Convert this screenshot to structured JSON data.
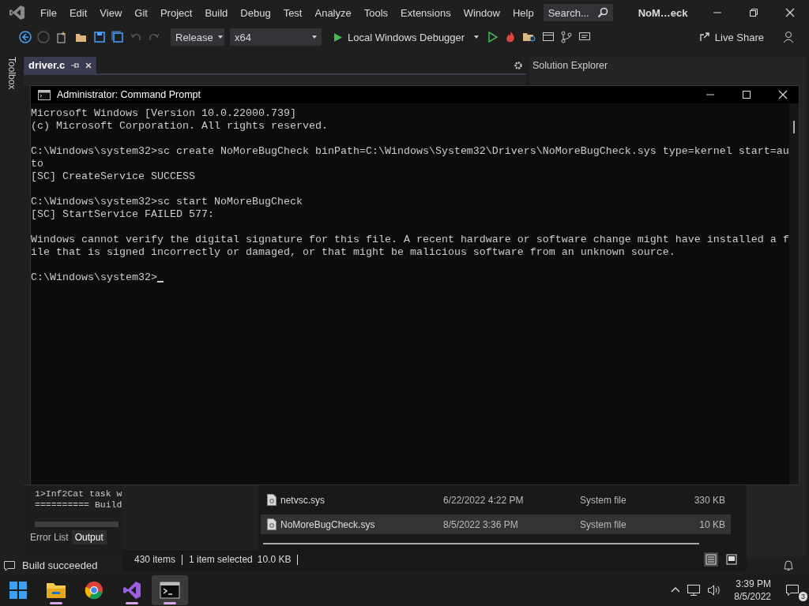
{
  "ide": {
    "title": "NoM…eck",
    "menu": [
      "File",
      "Edit",
      "View",
      "Git",
      "Project",
      "Build",
      "Debug",
      "Test",
      "Analyze",
      "Tools",
      "Extensions",
      "Window",
      "Help"
    ],
    "search": {
      "placeholder": "Search..."
    },
    "toolbar": {
      "configuration": "Release",
      "platform": "x64",
      "debugger": "Local Windows Debugger",
      "live_share": "Live Share"
    },
    "toolbox_label": "Toolbox",
    "document_tabs": [
      {
        "label": "driver.c",
        "selected": true
      }
    ],
    "solution_explorer": {
      "title": "Solution Explorer"
    },
    "output": {
      "lines": [
        "1>Inf2Cat task w",
        "========== Build"
      ],
      "tabs": [
        {
          "label": "Error List",
          "selected": false
        },
        {
          "label": "Output",
          "selected": true
        }
      ]
    },
    "status_bar": {
      "message": "Build succeeded"
    }
  },
  "console": {
    "title": "Administrator: Command Prompt",
    "blocks": [
      [
        "Microsoft Windows [Version 10.0.22000.739]",
        "(c) Microsoft Corporation. All rights reserved."
      ],
      [
        "C:\\Windows\\system32>sc create NoMoreBugCheck binPath=C:\\Windows\\System32\\Drivers\\NoMoreBugCheck.sys type=kernel start=au",
        "to",
        "[SC] CreateService SUCCESS"
      ],
      [
        "C:\\Windows\\system32>sc start NoMoreBugCheck",
        "[SC] StartService FAILED 577:"
      ],
      [
        "Windows cannot verify the digital signature for this file. A recent hardware or software change might have installed a f",
        "ile that is signed incorrectly or damaged, or that might be malicious software from an unknown source."
      ]
    ],
    "prompt": {
      "text": "C:\\Windows\\system32>",
      "cursor": true
    }
  },
  "file_explorer": {
    "files": [
      {
        "name": "netvsc.sys",
        "date": "6/22/2022 4:22 PM",
        "type": "System file",
        "size": "330 KB",
        "selected": false
      },
      {
        "name": "NoMoreBugCheck.sys",
        "date": "8/5/2022 3:36 PM",
        "type": "System file",
        "size": "10 KB",
        "selected": true
      }
    ],
    "status": {
      "count": "430 items",
      "selection": "1 item selected",
      "size": "10.0 KB"
    },
    "views": [
      {
        "kind": "details",
        "selected": true
      },
      {
        "kind": "tiles",
        "selected": false
      }
    ]
  },
  "taskbar": {
    "apps": [
      {
        "kind": "start",
        "running": false,
        "selected": false
      },
      {
        "kind": "folder",
        "running": true,
        "selected": false
      },
      {
        "kind": "browser",
        "running": false,
        "selected": false
      },
      {
        "kind": "studio",
        "running": true,
        "selected": false
      },
      {
        "kind": "terminal",
        "running": true,
        "selected": true
      }
    ],
    "time": "3:39 PM",
    "date": "8/5/2022",
    "notification_count": "3"
  }
}
